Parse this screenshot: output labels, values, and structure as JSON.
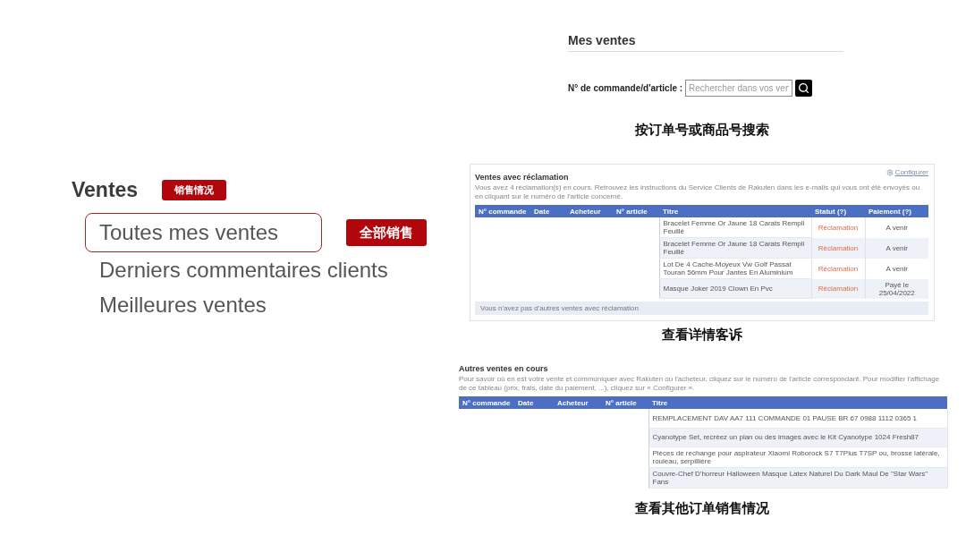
{
  "sidebar": {
    "heading": "Ventes",
    "heading_tag": "销售情况",
    "items": [
      {
        "label": "Toutes mes ventes",
        "selected": true,
        "tag": "全部销售"
      },
      {
        "label": "Derniers commentaires clients",
        "selected": false
      },
      {
        "label": "Meilleures ventes",
        "selected": false
      }
    ]
  },
  "search": {
    "title": "Mes ventes",
    "label": "N° de commande/d'article :",
    "placeholder": "Rechercher dans vos ven",
    "caption": "按订单号或商品号搜索"
  },
  "claims": {
    "title": "Ventes avec réclamation",
    "link": "Configurer",
    "description": "Vous avez 4 réclamation(s) en cours. Retrouvez les instructions du Service Clients de Rakuten dans les e-mails qui vous ont été envoyés ou en cliquant sur le numéro de l'article concerné.",
    "columns": [
      "N° commande",
      "Date",
      "Acheteur",
      "N° article",
      "Titre",
      "Statut (?)",
      "Paiement (?)"
    ],
    "rows": [
      {
        "title": "Bracelet Femme Or Jaune 18 Carats Rempli Feuillé",
        "status": "Réclamation",
        "payment": "A venir"
      },
      {
        "title": "Bracelet Femme Or Jaune 18 Carats Rempli Feuillé",
        "status": "Réclamation",
        "payment": "A venir"
      },
      {
        "title": "Lot De 4 Cache-Moyeux Vw Golf Passat Touran 56mm Pour Jantes En Aluminium",
        "status": "Réclamation",
        "payment": "A venir"
      },
      {
        "title": "Masque Joker 2019 Clown En Pvc",
        "status": "Réclamation",
        "payment": "Payé le 25/04/2022"
      }
    ],
    "footer": "Vous n'avez pas d'autres ventes avec réclamation",
    "caption": "查看详情客诉"
  },
  "other_sales": {
    "title": "Autres ventes en cours",
    "description": "Pour savoir où en est votre vente et communiquer avec Rakuten ou l'acheteur, cliquez sur le numéro de l'article correspondant. Pour modifier l'affichage de ce tableau (prix, frais, date du paiement, ...), cliquez sur « Configurer ».",
    "columns": [
      "N° commande",
      "Date",
      "Acheteur",
      "N° article",
      "Titre"
    ],
    "rows": [
      {
        "title": "REMPLACEMENT DAV AA7 111 COMMANDE 01 PAUSE BR 67 0988 1112 0365 1"
      },
      {
        "title": "Cyanotype Set, recréez un plan ou des images avec le Kit Cyanotype 1024 Fresh87"
      },
      {
        "title": "Pièces de rechange pour aspirateur Xiaomi Roborock S7 T7Plus T7SP ou, brosse latérale, rouleau, serpillière"
      },
      {
        "title": "Couvre-Chef D'horreur Halloween Masque Latex Naturel Du Dark Maul De \"Star Wars\" Fans"
      }
    ],
    "caption": "查看其他订单销售情况"
  }
}
